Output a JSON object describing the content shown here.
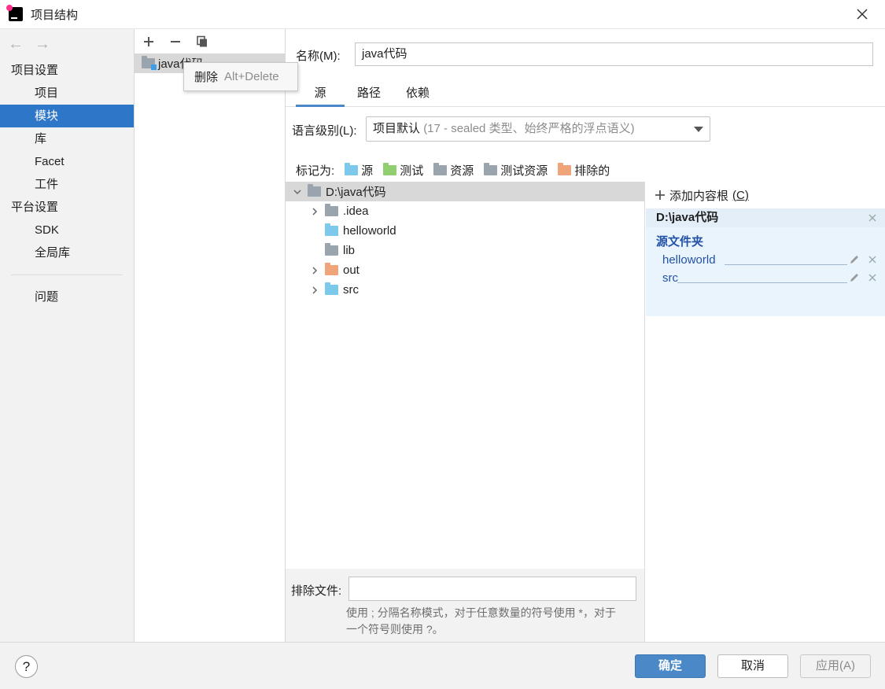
{
  "window": {
    "title": "项目结构"
  },
  "nav": {
    "groups": [
      {
        "label": "项目设置",
        "items": [
          "项目",
          "模块",
          "库",
          "Facet",
          "工件"
        ]
      },
      {
        "label": "平台设置",
        "items": [
          "SDK",
          "全局库"
        ]
      }
    ],
    "selected": "模块",
    "problems": "问题"
  },
  "modules": {
    "items": [
      "java代码"
    ]
  },
  "tooltip": {
    "label": "删除",
    "shortcut": "Alt+Delete"
  },
  "module_settings": {
    "name_label": "名称(M):",
    "name_value": "java代码",
    "tabs": [
      "源",
      "路径",
      "依赖"
    ],
    "active_tab": "源",
    "language_level_label": "语言级别(L):",
    "language_level_value": "项目默认",
    "language_level_detail": "(17 - sealed 类型、始终严格的浮点语义)",
    "mark_as_label": "标记为:",
    "mark_as": [
      {
        "label": "源",
        "color": "#7cc9ec"
      },
      {
        "label": "测试",
        "color": "#8fcf6f"
      },
      {
        "label": "资源",
        "color": "#9aa4ae"
      },
      {
        "label": "测试资源",
        "color": "#9aa4ae"
      },
      {
        "label": "排除的",
        "color": "#f0a47a"
      }
    ]
  },
  "tree": {
    "root": "D:\\java代码",
    "children": [
      {
        "name": ".idea",
        "expandable": true,
        "color": "gray"
      },
      {
        "name": "helloworld",
        "expandable": false,
        "color": "blue"
      },
      {
        "name": "lib",
        "expandable": false,
        "color": "gray"
      },
      {
        "name": "out",
        "expandable": true,
        "color": "orange"
      },
      {
        "name": "src",
        "expandable": true,
        "color": "blue"
      }
    ]
  },
  "content_roots": {
    "add_label": "添加内容根",
    "add_shortcut": "(C)",
    "root": "D:\\java代码",
    "source_folders_heading": "源文件夹",
    "source_folders": [
      "helloworld",
      "src"
    ]
  },
  "exclude": {
    "label": "排除文件:",
    "value": "",
    "help_line1": "使用 ; 分隔名称模式，对于任意数量的符号使用 *，对于",
    "help_line2": "一个符号则使用 ?。"
  },
  "footer": {
    "help": "?",
    "ok": "确定",
    "cancel": "取消",
    "apply": "应用(A)"
  }
}
